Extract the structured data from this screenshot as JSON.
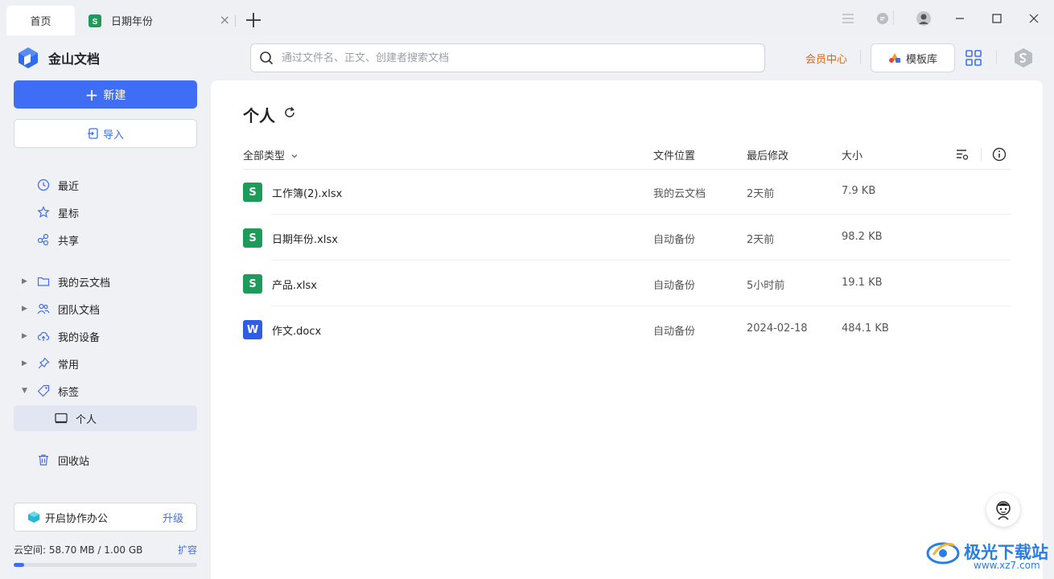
{
  "titlebar": {
    "tabs": [
      {
        "label": "首页"
      },
      {
        "label": "日期年份"
      }
    ],
    "close_glyph": "×",
    "add_glyph": "+"
  },
  "brand": {
    "name": "金山文档"
  },
  "search": {
    "placeholder": "通过文件名、正文、创建者搜索文档"
  },
  "header": {
    "vip_label": "会员中心",
    "template_label": "模板库"
  },
  "sidebar": {
    "new_label": "新建",
    "import_label": "导入",
    "quick": [
      {
        "label": "最近",
        "icon": "clock-icon"
      },
      {
        "label": "星标",
        "icon": "star-icon"
      },
      {
        "label": "共享",
        "icon": "share-icon"
      }
    ],
    "tree": [
      {
        "label": "我的云文档",
        "icon": "folder-icon"
      },
      {
        "label": "团队文档",
        "icon": "team-icon"
      },
      {
        "label": "我的设备",
        "icon": "cloud-upload-icon"
      },
      {
        "label": "常用",
        "icon": "pin-icon"
      },
      {
        "label": "标签",
        "icon": "tag-icon"
      }
    ],
    "active_item": "个人",
    "trash_label": "回收站",
    "collab_label": "开启协作办公",
    "upgrade_label": "升级",
    "storage_text": "云空间: 58.70 MB / 1.00 GB",
    "expand_label": "扩容",
    "storage_used_fraction": 0.057
  },
  "main": {
    "title": "个人",
    "columns": {
      "type_filter": "全部类型",
      "location": "文件位置",
      "modified": "最后修改",
      "size": "大小"
    },
    "files": [
      {
        "name": "工作簿(2).xlsx",
        "location": "我的云文档",
        "modified": "2天前",
        "size": "7.9 KB",
        "kind": "S",
        "color": "#1e9a5a"
      },
      {
        "name": "日期年份.xlsx",
        "location": "自动备份",
        "modified": "2天前",
        "size": "98.2 KB",
        "kind": "S",
        "color": "#1e9a5a"
      },
      {
        "name": "产品.xlsx",
        "location": "自动备份",
        "modified": "5小时前",
        "size": "19.1 KB",
        "kind": "S",
        "color": "#1e9a5a"
      },
      {
        "name": "作文.docx",
        "location": "自动备份",
        "modified": "2024-02-18",
        "size": "484.1 KB",
        "kind": "W",
        "color": "#2f5de6"
      }
    ]
  },
  "watermark": {
    "text": "极光下载站",
    "url": "www.xz7.com"
  },
  "colors": {
    "accent": "#3f6ef4",
    "sheet": "#1e9a5a",
    "doc": "#2f5de6",
    "vip": "#d2691e"
  }
}
